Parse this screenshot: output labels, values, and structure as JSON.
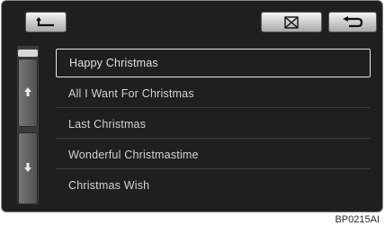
{
  "toolbar": {
    "up_button_icon": "up-level-arrow-icon",
    "delete_button_icon": "delete-x-box-icon",
    "back_button_icon": "return-arrow-icon"
  },
  "scrollbar": {
    "up_icon": "scroll-up-arrow-icon",
    "down_icon": "scroll-down-arrow-icon"
  },
  "playlist": {
    "items": [
      {
        "label": "Happy Christmas",
        "selected": true
      },
      {
        "label": "All I Want For Christmas",
        "selected": false
      },
      {
        "label": "Last Christmas",
        "selected": false
      },
      {
        "label": "Wonderful Christmastime",
        "selected": false
      },
      {
        "label": "Christmas Wish",
        "selected": false
      }
    ]
  },
  "figure_code": "BP0215AI",
  "colors": {
    "screen_bg": "#1f1f1f",
    "text": "#d2d2d2",
    "selection_border": "#e8e8e8"
  }
}
